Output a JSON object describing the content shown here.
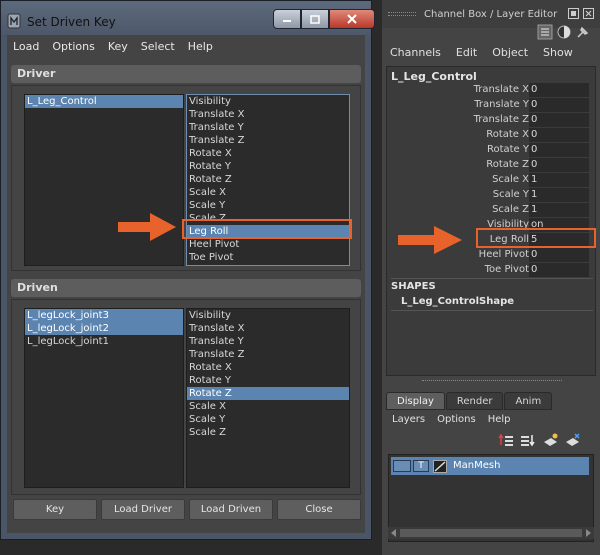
{
  "sdk": {
    "title": "Set Driven Key",
    "menu": [
      "Load",
      "Options",
      "Key",
      "Select",
      "Help"
    ],
    "driver": {
      "header": "Driver",
      "objects": [
        {
          "label": "L_Leg_Control",
          "selected": true
        }
      ],
      "attributes": [
        {
          "label": "Visibility",
          "selected": false
        },
        {
          "label": "Translate X",
          "selected": false
        },
        {
          "label": "Translate Y",
          "selected": false
        },
        {
          "label": "Translate Z",
          "selected": false
        },
        {
          "label": "Rotate X",
          "selected": false
        },
        {
          "label": "Rotate Y",
          "selected": false
        },
        {
          "label": "Rotate Z",
          "selected": false
        },
        {
          "label": "Scale X",
          "selected": false
        },
        {
          "label": "Scale Y",
          "selected": false
        },
        {
          "label": "Scale Z",
          "selected": false
        },
        {
          "label": "Leg Roll",
          "selected": true
        },
        {
          "label": "Heel Pivot",
          "selected": false
        },
        {
          "label": "Toe Pivot",
          "selected": false
        }
      ]
    },
    "driven": {
      "header": "Driven",
      "objects": [
        {
          "label": "L_legLock_joint3",
          "selected": true
        },
        {
          "label": "L_legLock_joint2",
          "selected": true
        },
        {
          "label": "L_legLock_joint1",
          "selected": false
        }
      ],
      "attributes": [
        {
          "label": "Visibility",
          "selected": false
        },
        {
          "label": "Translate X",
          "selected": false
        },
        {
          "label": "Translate Y",
          "selected": false
        },
        {
          "label": "Translate Z",
          "selected": false
        },
        {
          "label": "Rotate X",
          "selected": false
        },
        {
          "label": "Rotate Y",
          "selected": false
        },
        {
          "label": "Rotate Z",
          "selected": true
        },
        {
          "label": "Scale X",
          "selected": false
        },
        {
          "label": "Scale Y",
          "selected": false
        },
        {
          "label": "Scale Z",
          "selected": false
        }
      ]
    },
    "buttons": [
      "Key",
      "Load Driver",
      "Load Driven",
      "Close"
    ]
  },
  "channel_box": {
    "title": "Channel Box / Layer Editor",
    "menu": [
      "Channels",
      "Edit",
      "Object",
      "Show"
    ],
    "object": "L_Leg_Control",
    "attributes": [
      {
        "label": "Translate X",
        "value": "0"
      },
      {
        "label": "Translate Y",
        "value": "0"
      },
      {
        "label": "Translate Z",
        "value": "0"
      },
      {
        "label": "Rotate X",
        "value": "0"
      },
      {
        "label": "Rotate Y",
        "value": "0"
      },
      {
        "label": "Rotate Z",
        "value": "0"
      },
      {
        "label": "Scale X",
        "value": "1"
      },
      {
        "label": "Scale Y",
        "value": "1"
      },
      {
        "label": "Scale Z",
        "value": "1"
      },
      {
        "label": "Visibility",
        "value": "on"
      },
      {
        "label": "Leg Roll",
        "value": "5"
      },
      {
        "label": "Heel Pivot",
        "value": "0"
      },
      {
        "label": "Toe Pivot",
        "value": "0"
      }
    ],
    "shapes_header": "SHAPES",
    "shape_name": "L_Leg_ControlShape"
  },
  "layer_editor": {
    "tabs": [
      {
        "label": "Display",
        "active": true
      },
      {
        "label": "Render",
        "active": false
      },
      {
        "label": "Anim",
        "active": false
      }
    ],
    "menu": [
      "Layers",
      "Options",
      "Help"
    ],
    "layers": [
      {
        "vis": "",
        "type": "T",
        "name": "ManMesh"
      }
    ]
  },
  "colors": {
    "selection": "#5c84b0",
    "highlight": "#e8632b",
    "panel_bg": "#444444"
  }
}
